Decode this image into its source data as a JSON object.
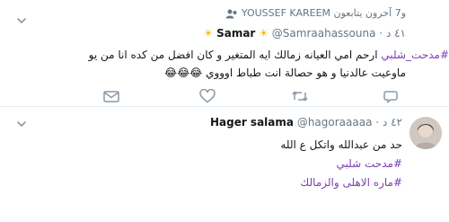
{
  "tweet1": {
    "social_context": "YOUSSEF KAREEM و7 آخرون يتابعون",
    "name": "Samar",
    "handle": "@Samraahassouna",
    "time": "٤١ د",
    "line1_hashtag": "#مدحت_شلبي",
    "line1_text": "ارحم امي العيانه زمالك ايه المتغير و كان افضل من كده انا من يو",
    "line2_text": "ماوعيت عالدنيا و هو حصالة انت طباط اوووي",
    "emoji": "😂😂😂",
    "actions": {
      "reply": "",
      "retweet": "",
      "like": "",
      "dm": ""
    }
  },
  "tweet2": {
    "name": "Hager salama",
    "handle": "@hagoraaaaa",
    "time": "٤٢ د",
    "lines": [
      "حد من عبدالله واتكل ع الله",
      "#مدحت شلبي",
      "#ماره الاهلى والزمالك"
    ]
  },
  "colors": {
    "hashtag": "#7b3fb4",
    "muted": "#657786",
    "sun": "#f5b400"
  }
}
